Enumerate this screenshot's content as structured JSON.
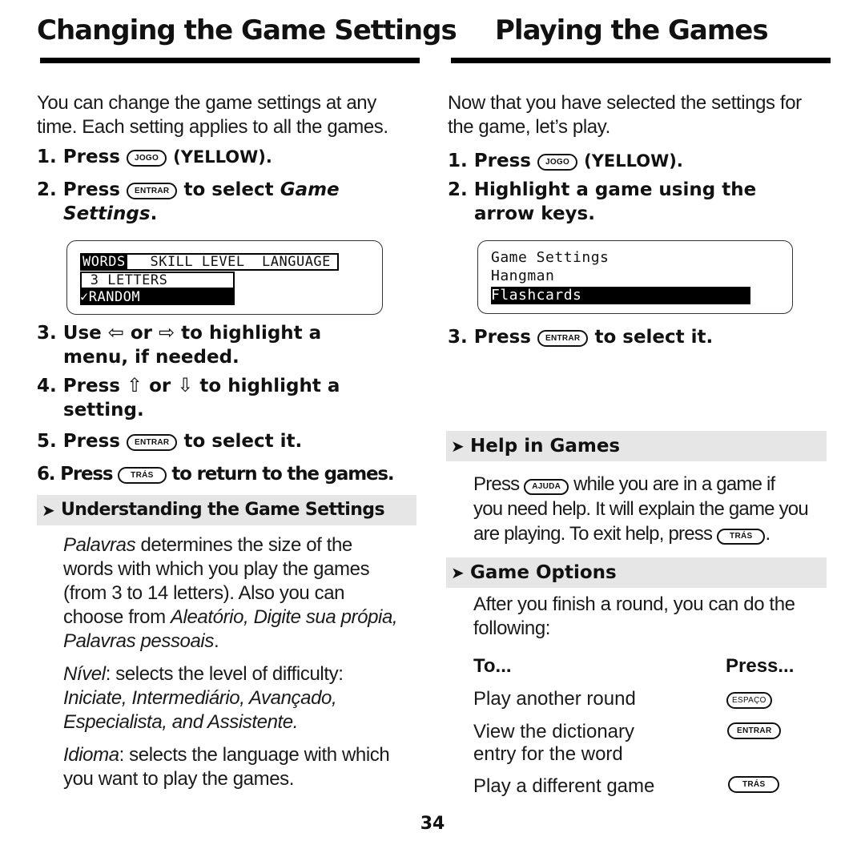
{
  "left": {
    "title": "Changing the Game Settings",
    "intro": "You can change the game settings at any time. Each setting applies to all the games.",
    "steps": [
      {
        "num": "1.",
        "before": "Press",
        "key": "JOGO",
        "after": "(YELLOW)."
      },
      {
        "num": "2.",
        "before": "Press",
        "key": "ENTRAR",
        "after": "to select",
        "italic": "Game",
        "line2_italic": "Settings",
        "line2_after": "."
      },
      {
        "num": "3.",
        "before": "Use",
        "arrow1": "⇦",
        "mid": "or",
        "arrow2": "⇨",
        "after": "to highlight a",
        "line2": "menu, if needed."
      },
      {
        "num": "4.",
        "before": "Press",
        "arrow1": "⇧",
        "mid": "or",
        "arrow2": "⇩",
        "after": "to highlight a",
        "line2": "setting."
      },
      {
        "num": "5.",
        "before": "Press",
        "key": "ENTRAR",
        "after": "to select it."
      },
      {
        "num": "6.",
        "before": "Press",
        "key": "TRÁS",
        "after": "to return to the games."
      }
    ],
    "screen": {
      "menu_selected": "WORDS",
      "menu_rest": "  SKILL LEVEL  LANGUAGE",
      "option1": " 3 LETTERS",
      "option2": "✓RANDOM"
    },
    "section": {
      "icon": "chevron-right-icon",
      "title": "Understanding the Game Settings"
    },
    "paragraphs": [
      {
        "lead": "Palavras",
        "text": " determines the size of the words with which you play the games (from 3 to 14 letters). Also you can choose from ",
        "italic_tail": "Aleatório, Digite sua própia, Palavras pessoais",
        "end": "."
      },
      {
        "lead": "Nível",
        "text": ": selects the level of difficulty: ",
        "italic_tail": "Iniciate, Intermediário, Avançado, Especialista, and Assistente.",
        "end": ""
      },
      {
        "lead": "Idioma",
        "text": ": selects the language with which you want to play the games.",
        "italic_tail": "",
        "end": ""
      }
    ]
  },
  "right": {
    "title": "Playing the Games",
    "intro": "Now that you have selected the settings for the game, let’s play.",
    "steps": [
      {
        "num": "1.",
        "before": "Press",
        "key": "JOGO",
        "after": "(YELLOW)."
      },
      {
        "num": "2.",
        "text": "Highlight a game using the",
        "line2": "arrow keys."
      },
      {
        "num": "3.",
        "before": "Press",
        "key": "ENTRAR",
        "after": "to select it."
      }
    ],
    "screen": {
      "items": [
        "Game Settings",
        "Hangman",
        "Flashcards"
      ],
      "selected_index": 2
    },
    "help_section": {
      "icon": "chevron-right-icon",
      "title": "Help in Games",
      "line1_before": "Press",
      "key1": "AJUDA",
      "line1_after": "while you are in a game if",
      "line2": "you need help. It will explain the game you",
      "line3_before": "are playing. To exit help, press",
      "key2": "TRÁS",
      "line3_after": "."
    },
    "options_section": {
      "icon": "chevron-right-icon",
      "title": "Game Options",
      "intro": "After you finish a round, you can do the following:",
      "col_to": "To...",
      "col_press": "Press...",
      "rows": [
        {
          "action": "Play another round",
          "key": "ESPAÇO"
        },
        {
          "action": "View the dictionary entry for the word",
          "key": "ENTRAR"
        },
        {
          "action": "Play a different game",
          "key": "TRÁS"
        }
      ]
    }
  },
  "page_number": "34"
}
